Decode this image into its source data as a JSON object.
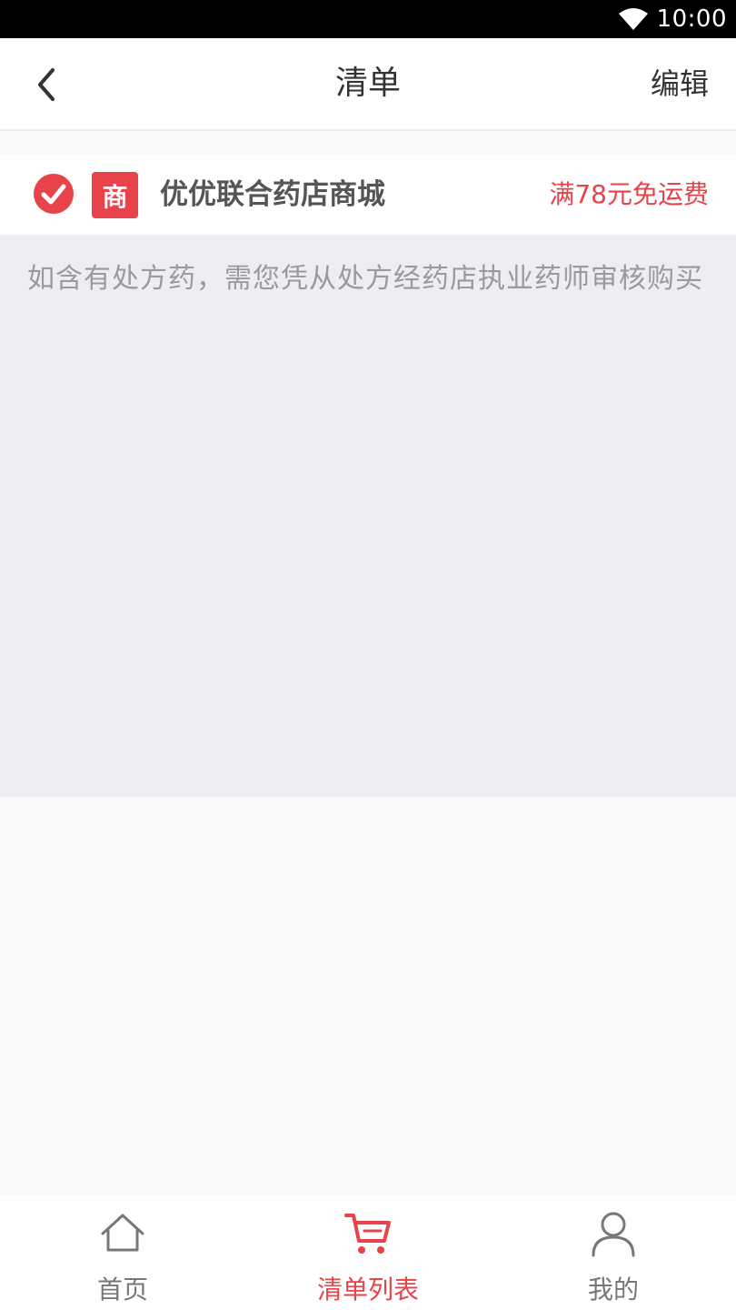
{
  "status_bar": {
    "time": "10:00",
    "wifi_icon": "wifi-icon"
  },
  "nav": {
    "back_icon": "chevron-left-icon",
    "title": "清单",
    "edit_label": "编辑"
  },
  "shop": {
    "selected": true,
    "check_icon": "check-circle-icon",
    "badge_text": "商",
    "name": "优优联合药店商城",
    "promo": "满78元免运费"
  },
  "notice": "如含有处方药，需您凭从处方经药店执业药师审核购买",
  "tabs": [
    {
      "label": "首页",
      "icon": "home-icon",
      "active": false
    },
    {
      "label": "清单列表",
      "icon": "cart-icon",
      "active": true
    },
    {
      "label": "我的",
      "icon": "user-icon",
      "active": false
    }
  ],
  "colors": {
    "accent": "#e8434a",
    "notice_bg": "#eeeef2",
    "page_bg": "#fafafa"
  }
}
